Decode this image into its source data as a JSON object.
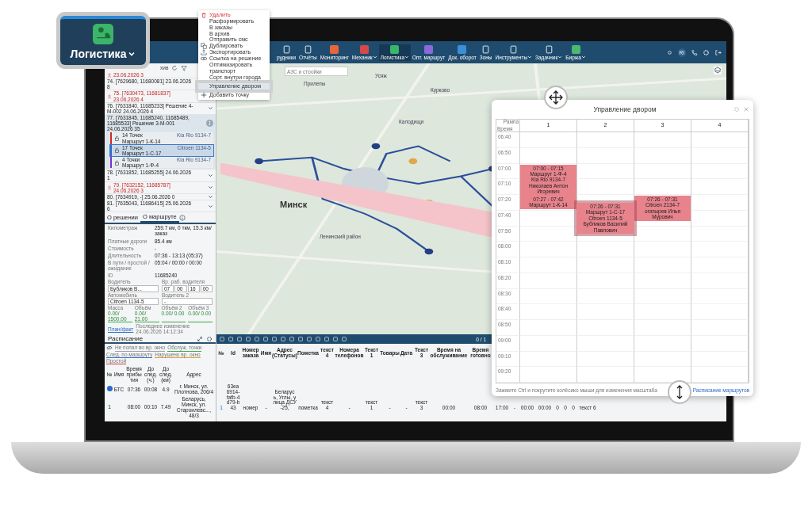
{
  "logo_callout": {
    "label": "Логистика"
  },
  "context_menu": {
    "items": [
      {
        "label": "Удалить",
        "kind": "delete",
        "selected": false
      },
      {
        "label": "Расформировать",
        "kind": "plain",
        "selected": false
      },
      {
        "label": "В заказы",
        "kind": "plain",
        "selected": false
      },
      {
        "label": "В архив",
        "kind": "plain",
        "selected": false
      },
      {
        "label": "Отправить смс",
        "kind": "plain",
        "selected": false
      },
      {
        "label": "Дублировать",
        "kind": "copy",
        "selected": false
      },
      {
        "label": "Экспортировать",
        "kind": "export",
        "selected": false
      },
      {
        "label": "Ссылка на решение",
        "kind": "link",
        "selected": false
      },
      {
        "label": "Оптимизировать транспорт",
        "kind": "plain",
        "selected": false
      },
      {
        "label": "Сорт. внутри города",
        "kind": "plain",
        "selected": false
      },
      {
        "label": "Управление двором",
        "kind": "plain",
        "selected": true
      },
      {
        "label": "Добавить точку",
        "kind": "add",
        "selected": false
      }
    ]
  },
  "top_nav": {
    "items": [
      {
        "label": "рудники",
        "selected": false,
        "dropdown": false
      },
      {
        "label": "Отчёты",
        "selected": false,
        "dropdown": false
      },
      {
        "label": "Мониторинг",
        "selected": false,
        "dropdown": false,
        "color": "#e8663a"
      },
      {
        "label": "Механик",
        "selected": false,
        "dropdown": true,
        "color": "#d94848"
      },
      {
        "label": "Логистика",
        "selected": true,
        "dropdown": true,
        "color": "#3bb56a"
      },
      {
        "label": "Опт. маршрут",
        "selected": false,
        "dropdown": false,
        "color": "#8a6ad8"
      },
      {
        "label": "Док. оборот",
        "selected": false,
        "dropdown": false,
        "color": "#3a8fd8"
      },
      {
        "label": "Зоны",
        "selected": false,
        "dropdown": false
      },
      {
        "label": "Инструменты",
        "selected": false,
        "dropdown": true
      },
      {
        "label": "Задачник",
        "selected": false,
        "dropdown": true
      },
      {
        "label": "Биржа",
        "selected": false,
        "dropdown": true,
        "color": "#4cb870"
      }
    ],
    "user_initials": "RI"
  },
  "left_panel": {
    "tab": "хив",
    "orders": [
      {
        "text": "23.06.2026 3",
        "alert": true,
        "expanded": false
      },
      {
        "text": "74. [7629680, 11680081] 23.06.2026 8",
        "alert": false,
        "expanded": false
      },
      {
        "text": "75. [7630473, 11681837] 23.06.2026 4",
        "alert": true,
        "expanded": false
      },
      {
        "text": "76. [7631840, 11685233] Решение 4-М-002 24.06.2026 4",
        "alert": false,
        "expanded": false
      },
      {
        "text": "77. [7631845, 11685240, 11685489, 11685533] Решение 3-М-001 24.06.2026 35",
        "alert": false,
        "expanded": true,
        "routes": [
          {
            "points": "14 Точек",
            "route": "Маршрут 1-К-14",
            "vehicle": "Kia Rio 9134-7",
            "color": "#cc2a2a",
            "selected": false
          },
          {
            "points": "17 Точек",
            "route": "Маршрут 1-С-17",
            "vehicle": "Citroen 1134-5",
            "color": "#2a6acc",
            "selected": true
          },
          {
            "points": "4 Точки",
            "route": "Маршрут 1-Ф-4",
            "vehicle": "Kia Rio 9134-7",
            "color": "#7a32cc",
            "selected": false
          }
        ]
      },
      {
        "text": "78. [7631852, 11685255] 24.06.2026 1",
        "alert": false,
        "expanded": false
      },
      {
        "text": "79. [7632152, 11685787] 24.06.2026 3",
        "alert": true,
        "expanded": false
      },
      {
        "text": "80. [7634919, -] 25.06.2026 0",
        "alert": false,
        "expanded": false
      },
      {
        "text": "81. [7635043, 11686415] 25.06.2026 6",
        "alert": false,
        "expanded": false
      }
    ],
    "tabs": [
      {
        "label": "О решении",
        "selected": false
      },
      {
        "label": "О маршруте",
        "selected": true
      }
    ],
    "info": [
      {
        "label": "Километраж",
        "value": "259.7 км, 0 ткм, 15.3 км/заказ"
      },
      {
        "label": "Платные дороги",
        "value": "85.4 км"
      },
      {
        "label": "Стоимость",
        "value": "-"
      },
      {
        "label": "Длительность",
        "value": "07:36 - 13:13 (05:37)"
      },
      {
        "label": "В пути / простой / ожидание",
        "value": "05:04 / 00:00 / 00:00"
      },
      {
        "label": "ID",
        "value": "11685240"
      }
    ],
    "driver": {
      "label": "Водитель",
      "value": "Бубликов В..."
    },
    "work_time": {
      "label": "Вр. раб. водителя",
      "values": [
        "07",
        "00",
        "16",
        "00"
      ]
    },
    "vehicle": {
      "label": "Автомобиль",
      "value": "Citroen 1134-5"
    },
    "driver2": {
      "label": "Водитель 2",
      "value": "-"
    },
    "metrics": [
      {
        "label": "Масса",
        "value": "0.00/ 1500.00"
      },
      {
        "label": "Объём",
        "value": "0.00/ 21.00"
      },
      {
        "label": "Объём 2",
        "value": "0.00/ 0.00"
      },
      {
        "label": "Объём 3",
        "value": "0.00/ 0.00"
      }
    ],
    "plan_link": "План/факт",
    "last_change": "Последнее изменение 24.06.2026 14:12:34",
    "schedule": {
      "title": "Расписание",
      "legend": [
        {
          "label": "Не попал во вр. окно",
          "color": "#9aa0a6"
        },
        {
          "label": "Обслуж. точки",
          "color": "#3aa84a"
        },
        {
          "label": "След. по маршруту",
          "color": "#3a6ad0"
        },
        {
          "label": "Нарушено вр. окно",
          "color": "#e89a3a"
        },
        {
          "label": "Простой",
          "color": "#d43a3a"
        }
      ],
      "columns": [
        "№",
        "Имя",
        "Время прибытия",
        "До след. (ч.)",
        "До след. (км)",
        "Адрес"
      ],
      "rows": [
        {
          "kind": "depot",
          "name": "БТС",
          "arrival": "07:36",
          "hours": "00:08",
          "km": "4.9",
          "address": "г. Минск, ул. Плотнова, 206/4"
        },
        {
          "kind": "stop",
          "number": "1",
          "arrival": "08:00",
          "hours": "00:10",
          "km": "7.49",
          "address": "Беларусь, Минск, ул. Староилевс..., 48/3"
        }
      ]
    }
  },
  "map": {
    "search_placeholder": "АЗС и стройки",
    "labels": [
      "Усяж",
      "Прилепы",
      "Курково",
      "Калодищи",
      "Минск",
      "Ленинский район"
    ]
  },
  "orders_table": {
    "counter": "0 / 1",
    "columns": [
      "№",
      "Id",
      "Номер заказа",
      "Имя",
      "Адрес (Статусы)",
      "Пометка",
      "текст 4",
      "Номера телефонов",
      "Текст 1",
      "Товары",
      "Дата",
      "Текст 3",
      "Время на обслуживание",
      "Время готовно"
    ],
    "row": [
      "1",
      "63ea6914-fafb-4d79-b43",
      "номер",
      "-",
      "Беларусь, Углы, улица ДСУ-25,",
      "пометка",
      "текст 4",
      "-",
      "текст 1",
      "-",
      "-",
      "текст 3",
      "00:00",
      "08:00",
      "17:00",
      "-",
      "00:00",
      "00:00",
      "0",
      "0",
      "0",
      "текст 6"
    ]
  },
  "yard_dialog": {
    "title": "Управление двором",
    "corner_top": "Рампа",
    "corner_bottom": "Время",
    "ramps": [
      "1",
      "2",
      "3",
      "4"
    ],
    "rows": [
      {
        "time": "06:40",
        "cells": [
          null,
          null,
          null,
          null
        ]
      },
      {
        "time": "06:50",
        "cells": [
          null,
          null,
          null,
          null
        ]
      },
      {
        "time": "07:00",
        "cells": [
          {
            "lines": [
              "07:00 - 07:15",
              "Маршрут 1-Ф-4",
              "Kia Rio 9134-7",
              "Николаев Антон Игоревич"
            ],
            "selected": false
          },
          null,
          null,
          null
        ]
      },
      {
        "time": "07:10",
        "cells": [
          null,
          null,
          null,
          null
        ]
      },
      {
        "time": "07:20",
        "cells": [
          {
            "lines": [
              "07:27 - 07:42",
              "Маршрут 1-К-14"
            ],
            "selected": false
          },
          {
            "lines": [
              "07:26 - 07:31",
              "Маршрут 1-С-17",
              "Citroen 1134-5",
              "Бубликов Василий Павлович"
            ],
            "selected": true
          },
          {
            "lines": [
              "07:26 - 07:31",
              "Citroen 2134-7",
              "огатырев Илья Мурович"
            ],
            "selected": false
          },
          null
        ]
      },
      {
        "time": "07:40",
        "cells": [
          null,
          null,
          null,
          null
        ]
      },
      {
        "time": "07:50",
        "cells": [
          null,
          null,
          null,
          null
        ]
      },
      {
        "time": "08:00",
        "cells": [
          null,
          null,
          null,
          null
        ]
      },
      {
        "time": "08:10",
        "cells": [
          null,
          null,
          null,
          null
        ]
      },
      {
        "time": "08:20",
        "cells": [
          null,
          null,
          null,
          null
        ]
      },
      {
        "time": "08:30",
        "cells": [
          null,
          null,
          null,
          null
        ]
      },
      {
        "time": "08:40",
        "cells": [
          null,
          null,
          null,
          null
        ]
      },
      {
        "time": "08:50",
        "cells": [
          null,
          null,
          null,
          null
        ]
      },
      {
        "time": "09:00",
        "cells": [
          null,
          null,
          null,
          null
        ]
      },
      {
        "time": "09:10",
        "cells": [
          null,
          null,
          null,
          null
        ]
      },
      {
        "time": "09:20",
        "cells": [
          null,
          null,
          null,
          null
        ]
      }
    ],
    "hint": "Зажмите Ctrl и покрутите колёсико мыши для изменения масштаба",
    "link": "Расписание маршрутов"
  }
}
